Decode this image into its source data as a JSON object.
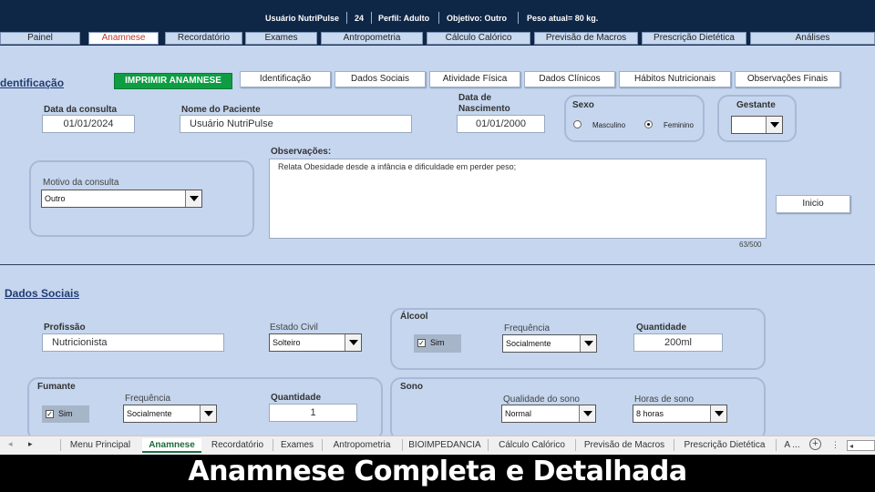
{
  "header": {
    "user": "Usuário NutriPulse",
    "age": "24",
    "profile": "Perfil:  Adulto",
    "goal": "Objetivo:  Outro",
    "weight": "Peso atual= 80 kg."
  },
  "nav": {
    "tabs": [
      "Painel",
      "Anamnese",
      "Recordatório",
      "Exames",
      "Antropometria",
      "Cálculo Calórico",
      "Previsão de Macros",
      "Prescrição Dietética",
      "Análises"
    ],
    "active": "Anamnese"
  },
  "identificacao": {
    "title": "dentificação",
    "print_button": "IMPRIMIR ANAMNESE",
    "subtabs": [
      "Identificação",
      "Dados Sociais",
      "Atividade Física",
      "Dados Clínicos",
      "Hábitos Nutricionais",
      "Observações Finais"
    ],
    "date_label": "Data da consulta",
    "date_value": "01/01/2024",
    "name_label": "Nome do Paciente",
    "name_value": "Usuário NutriPulse",
    "birth_label": "Data de Nascimento",
    "birth_value": "01/01/2000",
    "sex_label": "Sexo",
    "sex_options": [
      "Masculino",
      "Feminino"
    ],
    "sex_selected": "Feminino",
    "pregnant_label": "Gestante",
    "pregnant_value": "",
    "reason_label": "Motivo da consulta",
    "reason_value": "Outro",
    "obs_label": "Observações:",
    "obs_value": "Relata Obesidade desde a infância e dificuldade em perder peso;",
    "char_count": "63/500",
    "inicio_button": "Inicio"
  },
  "social": {
    "title": "Dados Sociais",
    "profession_label": "Profissão",
    "profession_value": "Nutricionista",
    "civil_label": "Estado Civil",
    "civil_value": "Solteiro",
    "alcohol": {
      "title": "Álcool",
      "checked_label": "Sim",
      "freq_label": "Frequência",
      "freq_value": "Socialmente",
      "qty_label": "Quantidade",
      "qty_value": "200ml"
    },
    "smoker": {
      "title": "Fumante",
      "checked_label": "Sim",
      "freq_label": "Frequência",
      "freq_value": "Socialmente",
      "qty_label": "Quantidade",
      "qty_value": "1"
    },
    "sleep": {
      "title": "Sono",
      "quality_label": "Qualidade do sono",
      "quality_value": "Normal",
      "hours_label": "Horas de sono",
      "hours_value": "8 horas"
    }
  },
  "sheets": {
    "tabs": [
      "Menu Principal",
      "Anamnese",
      "Recordatório",
      "Exames",
      "Antropometria",
      "BIOIMPEDANCIA",
      "Cálculo Calórico",
      "Previsão de Macros",
      "Prescrição Dietética",
      "A ..."
    ],
    "active": "Anamnese"
  },
  "caption": "Anamnese Completa e Detalhada",
  "colors": {
    "header_bg": "#0f2747",
    "page_bg": "#c5d6ee",
    "print_button": "#0f9d44",
    "active_nav_text": "#c0392b"
  }
}
